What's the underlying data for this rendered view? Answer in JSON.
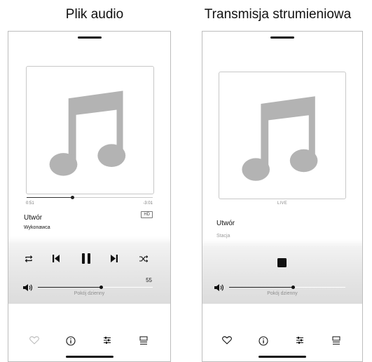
{
  "headings": {
    "left": "Plik audio",
    "right": "Transmisja strumieniowa"
  },
  "audio_file": {
    "track_title": "Utwór",
    "artist": "Wykonawca",
    "elapsed": "0:51",
    "remaining": "-3:01",
    "progress": 0.36,
    "quality_badge": "HD",
    "volume_value": "55",
    "volume_level": 0.55,
    "room": "Pokój dzienny",
    "controls": [
      "repeat-icon",
      "previous-icon",
      "pause-icon",
      "next-icon",
      "shuffle-icon"
    ],
    "tabs": [
      "favorite-icon",
      "info-icon",
      "equalizer-icon",
      "queue-icon"
    ]
  },
  "streaming": {
    "live_label": "LIVE",
    "track_title": "Utwór",
    "station": "Stacja",
    "volume_level": 0.55,
    "room": "Pokój dzienny",
    "controls": [
      "stop-icon"
    ],
    "tabs": [
      "favorite-icon",
      "info-icon",
      "equalizer-icon",
      "queue-icon"
    ]
  },
  "colors": {
    "art_note": "#b3b3b3",
    "favorite_inactive": "#bdbdbd",
    "icon": "#111111"
  }
}
